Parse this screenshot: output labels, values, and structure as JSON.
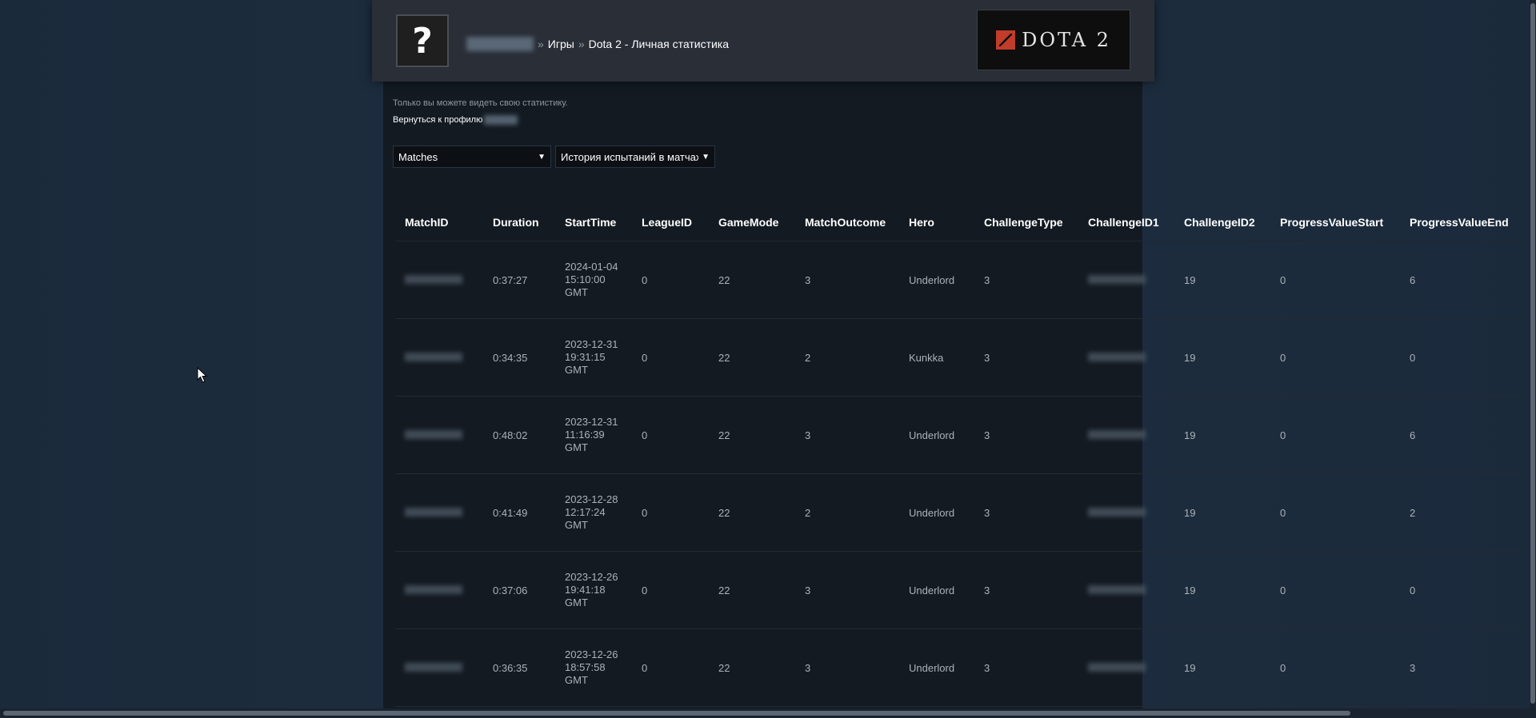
{
  "header": {
    "avatar_glyph": "?",
    "breadcrumb": {
      "separator": "»",
      "games": "Игры",
      "current": "Dota 2 - Личная статистика"
    },
    "game_logo_text": "DOTA 2",
    "game_logo_icon": "dota-emblem-icon",
    "accent_color": "#c23c2a"
  },
  "notice": "Только вы можете видеть свою статистику.",
  "back_link": "Вернуться к профилю",
  "filters": {
    "category": "Matches",
    "stat": "История испытаний в матчах"
  },
  "table": {
    "headers": [
      "MatchID",
      "Duration",
      "StartTime",
      "LeagueID",
      "GameMode",
      "MatchOutcome",
      "Hero",
      "ChallengeType",
      "ChallengeID1",
      "ChallengeID2",
      "ProgressValueStart",
      "ProgressValueEnd"
    ],
    "rows": [
      {
        "duration": "0:37:27",
        "start_time": "2024-01-04 15:10:00 GMT",
        "league_id": "0",
        "game_mode": "22",
        "match_outcome": "3",
        "hero": "Underlord",
        "challenge_type": "3",
        "challenge_id2": "19",
        "progress_start": "0",
        "progress_end": "6"
      },
      {
        "duration": "0:34:35",
        "start_time": "2023-12-31 19:31:15 GMT",
        "league_id": "0",
        "game_mode": "22",
        "match_outcome": "2",
        "hero": "Kunkka",
        "challenge_type": "3",
        "challenge_id2": "19",
        "progress_start": "0",
        "progress_end": "0"
      },
      {
        "duration": "0:48:02",
        "start_time": "2023-12-31 11:16:39 GMT",
        "league_id": "0",
        "game_mode": "22",
        "match_outcome": "3",
        "hero": "Underlord",
        "challenge_type": "3",
        "challenge_id2": "19",
        "progress_start": "0",
        "progress_end": "6"
      },
      {
        "duration": "0:41:49",
        "start_time": "2023-12-28 12:17:24 GMT",
        "league_id": "0",
        "game_mode": "22",
        "match_outcome": "2",
        "hero": "Underlord",
        "challenge_type": "3",
        "challenge_id2": "19",
        "progress_start": "0",
        "progress_end": "2"
      },
      {
        "duration": "0:37:06",
        "start_time": "2023-12-26 19:41:18 GMT",
        "league_id": "0",
        "game_mode": "22",
        "match_outcome": "3",
        "hero": "Underlord",
        "challenge_type": "3",
        "challenge_id2": "19",
        "progress_start": "0",
        "progress_end": "0"
      },
      {
        "duration": "0:36:35",
        "start_time": "2023-12-26 18:57:58 GMT",
        "league_id": "0",
        "game_mode": "22",
        "match_outcome": "3",
        "hero": "Underlord",
        "challenge_type": "3",
        "challenge_id2": "19",
        "progress_start": "0",
        "progress_end": "3"
      }
    ]
  }
}
